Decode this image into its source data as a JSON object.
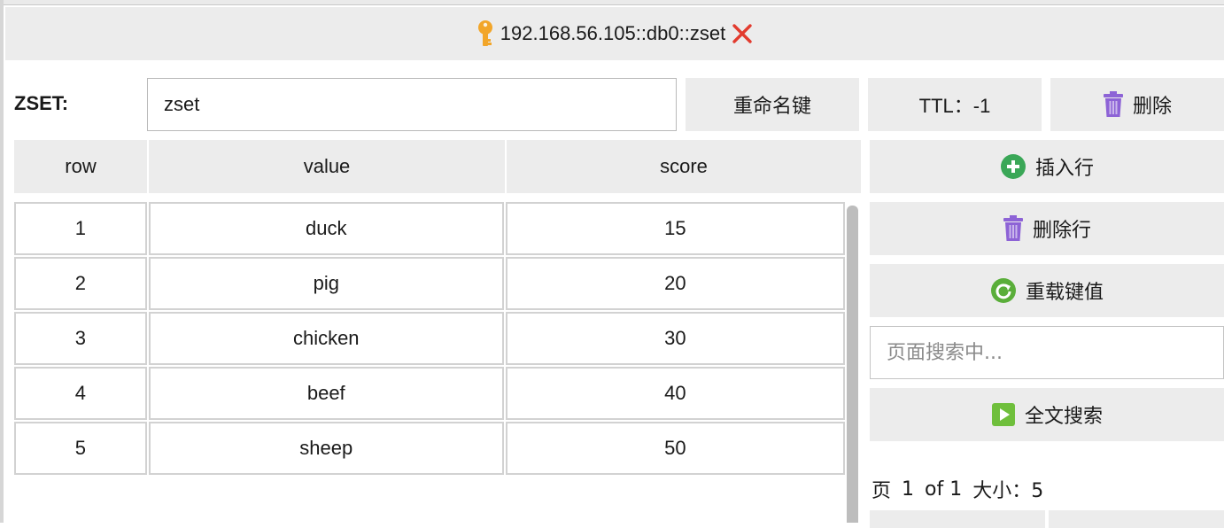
{
  "tab": {
    "title": "192.168.56.105::db0::zset",
    "key_icon": "key-icon",
    "close_icon": "close-icon",
    "close_color": "#e23b2e"
  },
  "key_bar": {
    "type_label": "ZSET:",
    "key_value": "zset",
    "rename_label": "重命名键",
    "ttl_label": "TTL：-1",
    "delete_label": "删除"
  },
  "table": {
    "columns": [
      "row",
      "value",
      "score"
    ],
    "rows": [
      {
        "row": "1",
        "value": "duck",
        "score": "15"
      },
      {
        "row": "2",
        "value": "pig",
        "score": "20"
      },
      {
        "row": "3",
        "value": "chicken",
        "score": "30"
      },
      {
        "row": "4",
        "value": "beef",
        "score": "40"
      },
      {
        "row": "5",
        "value": "sheep",
        "score": "50"
      }
    ]
  },
  "side": {
    "insert_label": "插入行",
    "delete_row_label": "删除行",
    "reload_label": "重载键值",
    "search_placeholder": "页面搜索中...",
    "fulltext_label": "全文搜索"
  },
  "pager": {
    "page_label": "页",
    "page_current": "1",
    "page_of": "of 1",
    "size_label": "大小：5"
  },
  "colors": {
    "trash": "#8d63d6",
    "add": "#3aa757",
    "reload": "#5aae3a",
    "play": "#6fbf3c",
    "key": "#f2a62a"
  }
}
